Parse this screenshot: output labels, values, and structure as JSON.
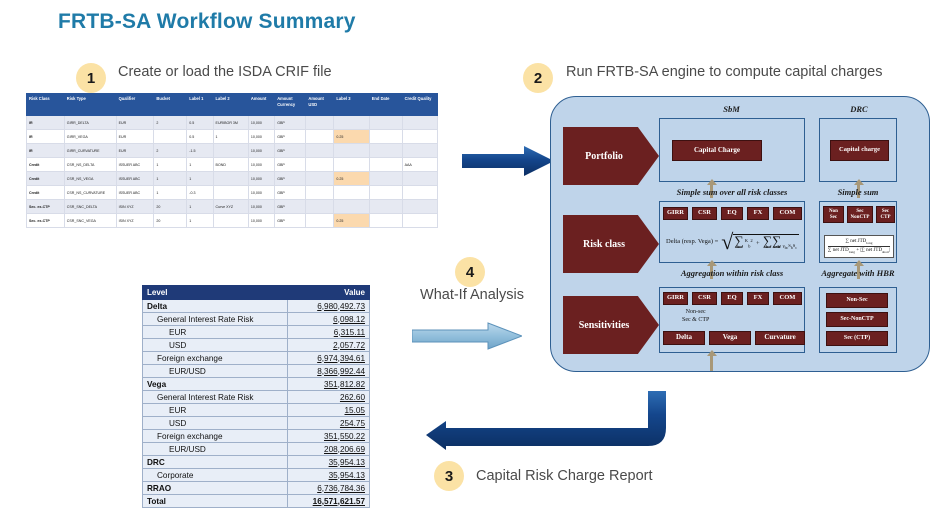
{
  "page": {
    "title": "FRTB-SA Workflow Summary",
    "title_color": "#1F7BA8"
  },
  "steps": [
    {
      "number": "1",
      "label": "Create or load the ISDA CRIF file"
    },
    {
      "number": "2",
      "label": "Run FRTB-SA engine to compute capital charges"
    },
    {
      "number": "3",
      "label": "Capital Risk Charge Report"
    },
    {
      "number": "4",
      "label": "What-If Analysis"
    }
  ],
  "crif_table": {
    "headers": [
      "Risk Class",
      "Risk Type",
      "Qualifier",
      "Bucket",
      "Label 1",
      "Label 2",
      "Amount",
      "Amount Currency",
      "Amount USD",
      "Label 3",
      "End Date",
      "Credit Quality"
    ],
    "rows": [
      {
        "risk_class": "IR",
        "risk_type": "GIRR_DELTA",
        "qualifier": "EUR",
        "bucket": "2",
        "label1": "0.5",
        "label2": "EURIBOR 3M",
        "amount": "10,000",
        "amount_currency": "GBP",
        "amount_usd": "",
        "label3": "",
        "end_date": "",
        "credit_quality": ""
      },
      {
        "risk_class": "IR",
        "risk_type": "GIRR_VEGA",
        "qualifier": "EUR",
        "bucket": "",
        "label1": "0.5",
        "label2": "1",
        "amount": "10,000",
        "amount_currency": "GBP",
        "amount_usd": "",
        "label3": "0.25",
        "end_date": "",
        "credit_quality": ""
      },
      {
        "risk_class": "IR",
        "risk_type": "GIRR_CURVATURE",
        "qualifier": "EUR",
        "bucket": "2",
        "label1": "-1.5",
        "label2": "",
        "amount": "10,000",
        "amount_currency": "GBP",
        "amount_usd": "",
        "label3": "",
        "end_date": "",
        "credit_quality": ""
      },
      {
        "risk_class": "Credit",
        "risk_type": "CSR_NS_DELTA",
        "qualifier": "ISSUER ABC",
        "bucket": "1",
        "label1": "1",
        "label2": "BOND",
        "amount": "10,000",
        "amount_currency": "GBP",
        "amount_usd": "",
        "label3": "",
        "end_date": "",
        "credit_quality": "AAA"
      },
      {
        "risk_class": "Credit",
        "risk_type": "CSR_NS_VEGA",
        "qualifier": "ISSUER ABC",
        "bucket": "1",
        "label1": "1",
        "label2": "",
        "amount": "10,000",
        "amount_currency": "GBP",
        "amount_usd": "",
        "label3": "0.25",
        "end_date": "",
        "credit_quality": ""
      },
      {
        "risk_class": "Credit",
        "risk_type": "CSR_NS_CURVATURE",
        "qualifier": "ISSUER ABC",
        "bucket": "1",
        "label1": "-0.3",
        "label2": "",
        "amount": "10,000",
        "amount_currency": "GBP",
        "amount_usd": "",
        "label3": "",
        "end_date": "",
        "credit_quality": ""
      },
      {
        "risk_class": "Sec. ex-CTP",
        "risk_type": "CSR_SNC_DELTA",
        "qualifier": "ISIN XYZ",
        "bucket": "20",
        "label1": "1",
        "label2": "Curve XYZ",
        "amount": "10,000",
        "amount_currency": "GBP",
        "amount_usd": "",
        "label3": "",
        "end_date": "",
        "credit_quality": ""
      },
      {
        "risk_class": "Sec. ex-CTP",
        "risk_type": "CSR_SNC_VEGA",
        "qualifier": "ISIN XYZ",
        "bucket": "20",
        "label1": "1",
        "label2": "",
        "amount": "10,000",
        "amount_currency": "GBP",
        "amount_usd": "",
        "label3": "0.25",
        "end_date": "",
        "credit_quality": ""
      }
    ]
  },
  "engine_diagram": {
    "column_headers": {
      "sbm": "SbM",
      "drc": "DRC"
    },
    "row_chevrons": {
      "portfolio": "Portfolio",
      "risk_class": "Risk class",
      "sensitivities": "Sensitivities"
    },
    "sbm": {
      "capital_charge": "Capital Charge",
      "aggregation_label_top": "Simple sum over all risk classes",
      "aggregation_label_bottom": "Aggregation within risk class",
      "risk_classes": [
        "GIRR",
        "CSR",
        "EQ",
        "FX",
        "COM"
      ],
      "formula_lhs": "Delta (resp. Vega) =",
      "sens_risk_classes": [
        "GIRR",
        "CSR",
        "EQ",
        "FX",
        "COM"
      ],
      "sens_note_line1": "Non-sec",
      "sens_note_line2": "Sec & CTP",
      "sens_measures": [
        "Delta",
        "Vega",
        "Curvature"
      ]
    },
    "drc": {
      "capital_charge": "Capital charge",
      "aggregation_label_top": "Simple sum",
      "aggregation_label_bottom": "Aggregate with HBR",
      "buckets": [
        "Non Sec",
        "Sec NonCTP",
        "Sec CTP"
      ],
      "hbr_numerator": "∑ net JTD",
      "hbr_numerator_sub": "long",
      "hbr_denominator": "∑ net JTD",
      "hbr_denominator_sub1": "long",
      "hbr_denominator_mid": " + |∑ net JTD",
      "hbr_denominator_sub2": "short",
      "hbr_denominator_end": "|",
      "sens_buckets": [
        "Non-Sec",
        "Sec-NonCTP",
        "Sec (CTP)"
      ]
    }
  },
  "results_table": {
    "headers": {
      "level": "Level",
      "value": "Value"
    },
    "rows": [
      {
        "level": 0,
        "label": "Delta",
        "value": "6,980,492.73"
      },
      {
        "level": 1,
        "label": "General Interest Rate Risk",
        "value": "6,098.12"
      },
      {
        "level": 2,
        "label": "EUR",
        "value": "6,315.11"
      },
      {
        "level": 2,
        "label": "USD",
        "value": "2,057.72"
      },
      {
        "level": 1,
        "label": "Foreign exchange",
        "value": "6,974,394.61"
      },
      {
        "level": 2,
        "label": "EUR/USD",
        "value": "8,366,992.44"
      },
      {
        "level": 0,
        "label": "Vega",
        "value": "351,812.82"
      },
      {
        "level": 1,
        "label": "General Interest Rate Risk",
        "value": "262.60"
      },
      {
        "level": 2,
        "label": "EUR",
        "value": "15.05"
      },
      {
        "level": 2,
        "label": "USD",
        "value": "254.75"
      },
      {
        "level": 1,
        "label": "Foreign exchange",
        "value": "351,550.22"
      },
      {
        "level": 2,
        "label": "EUR/USD",
        "value": "208,206.69"
      },
      {
        "level": 0,
        "label": "DRC",
        "value": "35,954.13"
      },
      {
        "level": 1,
        "label": "Corporate",
        "value": "35,954.13"
      },
      {
        "level": 0,
        "label": "RRAO",
        "value": "6,736,784.36"
      },
      {
        "level": 0,
        "label": "Total",
        "value": "16,571,621.57",
        "total": true
      }
    ]
  },
  "colors": {
    "title": "#1F7BA8",
    "badge": "#FBE2A5",
    "arrow_dark_blue": "#14468C",
    "arrow_light_blue": "#8FBDDC",
    "diagram_fill": "#BFD4EA",
    "diagram_border": "#2E5F92",
    "maroon": "#6B2020",
    "crif_header": "#28559B",
    "results_header": "#1F3A78",
    "highlight": "#FBD9AE"
  }
}
